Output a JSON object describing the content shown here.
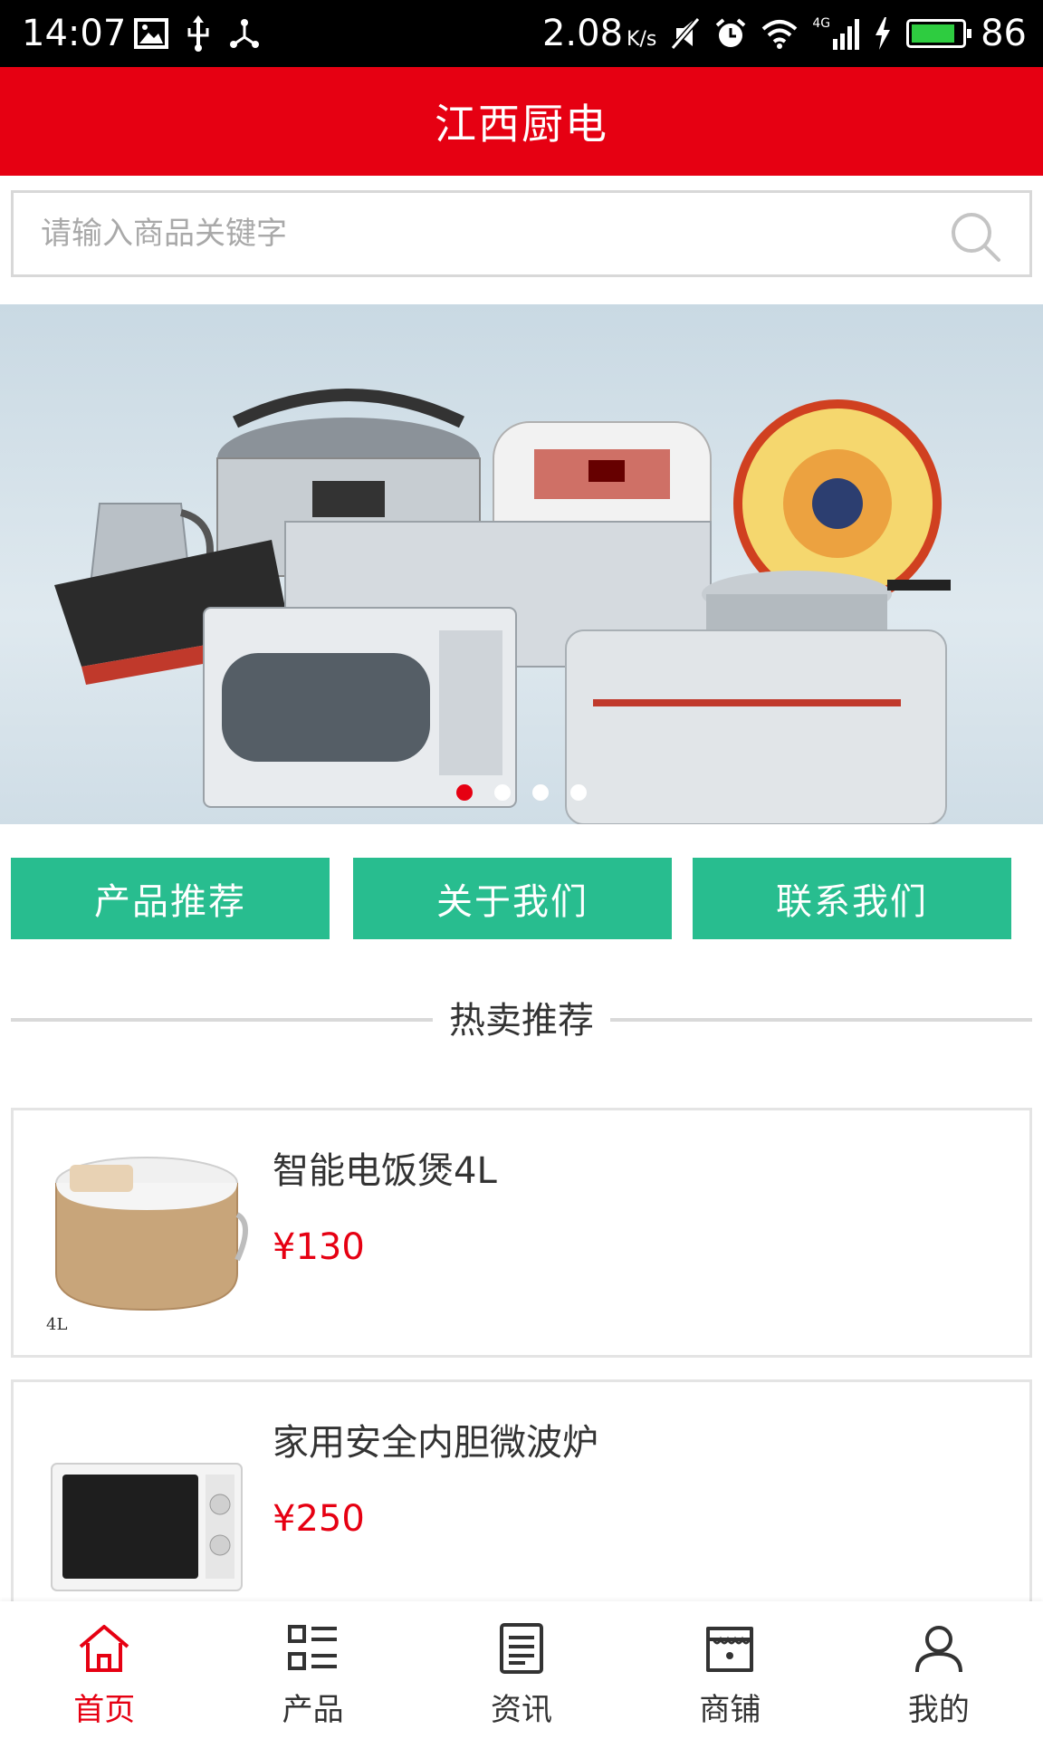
{
  "status_bar": {
    "time": "14:07",
    "speed": "2.08",
    "speed_unit": "K/s",
    "network": "4G",
    "battery": "86",
    "battery_level": 0.86
  },
  "header": {
    "title": "江西厨电"
  },
  "search": {
    "placeholder": "请输入商品关键字"
  },
  "banner": {
    "slide_count": 4,
    "active_index": 0
  },
  "quick_links": [
    {
      "label": "产品推荐"
    },
    {
      "label": "关于我们"
    },
    {
      "label": "联系我们"
    }
  ],
  "section": {
    "title": "热卖推荐"
  },
  "products": [
    {
      "name": "智能电饭煲4L",
      "price": "¥130",
      "image_label": "4L"
    },
    {
      "name": "家用安全内胆微波炉",
      "price": "¥250"
    }
  ],
  "bottom_nav": [
    {
      "label": "首页",
      "icon": "home-icon",
      "active": true
    },
    {
      "label": "产品",
      "icon": "list-icon",
      "active": false
    },
    {
      "label": "资讯",
      "icon": "news-icon",
      "active": false
    },
    {
      "label": "商铺",
      "icon": "shop-icon",
      "active": false
    },
    {
      "label": "我的",
      "icon": "user-icon",
      "active": false
    }
  ],
  "colors": {
    "brand": "#e60012",
    "accent": "#28bd8f"
  }
}
